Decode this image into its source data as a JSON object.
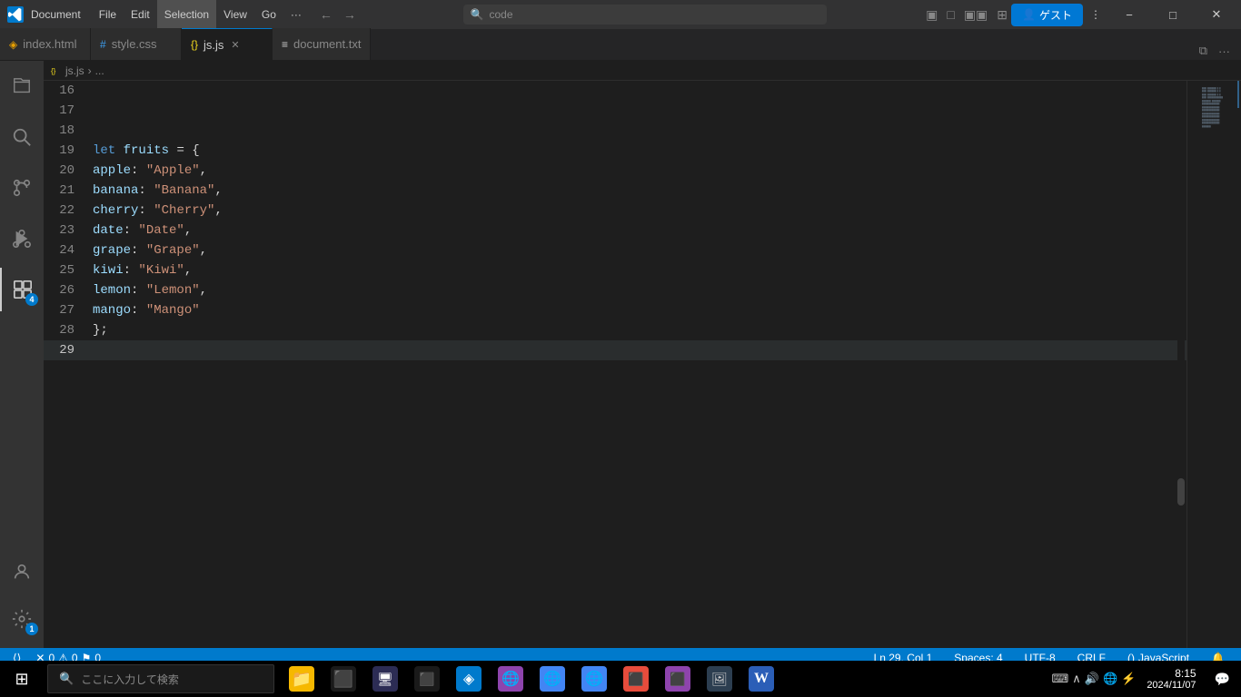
{
  "titlebar": {
    "app_icon": "VS",
    "doc_title": "Document",
    "menu": [
      "File",
      "Edit",
      "Selection",
      "View",
      "Go",
      "···"
    ],
    "search_placeholder": "code",
    "nav_back": "←",
    "nav_fwd": "→",
    "layout_btns": [
      "▣",
      "□",
      "▣▣",
      "⊞"
    ],
    "minimize": "−",
    "maximize": "□",
    "restore": "❐",
    "close": "✕",
    "outer_minimize": "—",
    "outer_maximize": "❐",
    "outer_close": "✕"
  },
  "tabs": [
    {
      "id": "index-html",
      "icon": "◈",
      "name": "index.html",
      "closable": false,
      "active": false,
      "color": "#e8a000"
    },
    {
      "id": "style-css",
      "icon": "#",
      "name": "style.css",
      "closable": false,
      "active": false,
      "color": "#3d9ded"
    },
    {
      "id": "js-js",
      "icon": "{}",
      "name": "js.js",
      "closable": true,
      "active": true,
      "color": "#f5dd1d"
    },
    {
      "id": "document-txt",
      "icon": "≡",
      "name": "document.txt",
      "closable": false,
      "active": false,
      "color": "#cccccc"
    }
  ],
  "breadcrumb": {
    "file": "js.js",
    "separator": "›",
    "rest": "..."
  },
  "code": {
    "lines": [
      {
        "num": 16,
        "content": "",
        "tokens": []
      },
      {
        "num": 17,
        "content": "",
        "tokens": []
      },
      {
        "num": 18,
        "content": "",
        "tokens": []
      },
      {
        "num": 19,
        "content": "let fruits = {",
        "tokens": [
          {
            "type": "kw",
            "text": "let"
          },
          {
            "type": "space",
            "text": " "
          },
          {
            "type": "var",
            "text": "fruits"
          },
          {
            "type": "op",
            "text": " = "
          },
          {
            "type": "brace",
            "text": "{"
          }
        ]
      },
      {
        "num": 20,
        "content": "    apple: \"Apple\",",
        "tokens": [
          {
            "type": "indent",
            "text": "    "
          },
          {
            "type": "key",
            "text": "apple"
          },
          {
            "type": "punct",
            "text": ": "
          },
          {
            "type": "str",
            "text": "\"Apple\""
          },
          {
            "type": "punct",
            "text": ","
          }
        ]
      },
      {
        "num": 21,
        "content": "    banana: \"Banana\",",
        "tokens": [
          {
            "type": "indent",
            "text": "    "
          },
          {
            "type": "key",
            "text": "banana"
          },
          {
            "type": "punct",
            "text": ": "
          },
          {
            "type": "str",
            "text": "\"Banana\""
          },
          {
            "type": "punct",
            "text": ","
          }
        ]
      },
      {
        "num": 22,
        "content": "    cherry: \"Cherry\",",
        "tokens": [
          {
            "type": "indent",
            "text": "    "
          },
          {
            "type": "key",
            "text": "cherry"
          },
          {
            "type": "punct",
            "text": ": "
          },
          {
            "type": "str",
            "text": "\"Cherry\""
          },
          {
            "type": "punct",
            "text": ","
          }
        ]
      },
      {
        "num": 23,
        "content": "    date: \"Date\",",
        "tokens": [
          {
            "type": "indent",
            "text": "    "
          },
          {
            "type": "key",
            "text": "date"
          },
          {
            "type": "punct",
            "text": ": "
          },
          {
            "type": "str",
            "text": "\"Date\""
          },
          {
            "type": "punct",
            "text": ","
          }
        ]
      },
      {
        "num": 24,
        "content": "    grape: \"Grape\",",
        "tokens": [
          {
            "type": "indent",
            "text": "    "
          },
          {
            "type": "key",
            "text": "grape"
          },
          {
            "type": "punct",
            "text": ": "
          },
          {
            "type": "str",
            "text": "\"Grape\""
          },
          {
            "type": "punct",
            "text": ","
          }
        ]
      },
      {
        "num": 25,
        "content": "    kiwi: \"Kiwi\",",
        "tokens": [
          {
            "type": "indent",
            "text": "    "
          },
          {
            "type": "key",
            "text": "kiwi"
          },
          {
            "type": "punct",
            "text": ": "
          },
          {
            "type": "str",
            "text": "\"Kiwi\""
          },
          {
            "type": "punct",
            "text": ","
          }
        ]
      },
      {
        "num": 26,
        "content": "    lemon: \"Lemon\",",
        "tokens": [
          {
            "type": "indent",
            "text": "    "
          },
          {
            "type": "key",
            "text": "lemon"
          },
          {
            "type": "punct",
            "text": ": "
          },
          {
            "type": "str",
            "text": "\"Lemon\""
          },
          {
            "type": "punct",
            "text": ","
          }
        ]
      },
      {
        "num": 27,
        "content": "    mango: \"Mango\"",
        "tokens": [
          {
            "type": "indent",
            "text": "    "
          },
          {
            "type": "key",
            "text": "mango"
          },
          {
            "type": "punct",
            "text": ": "
          },
          {
            "type": "str",
            "text": "\"Mango\""
          }
        ]
      },
      {
        "num": 28,
        "content": "};",
        "tokens": [
          {
            "type": "brace",
            "text": "}"
          },
          {
            "type": "punct",
            "text": ";"
          }
        ]
      },
      {
        "num": 29,
        "content": "",
        "tokens": [],
        "current": true
      }
    ]
  },
  "status": {
    "errors": "0",
    "warnings": "0",
    "messages": "0",
    "line": "Ln 29, Col 1",
    "spaces": "Spaces: 4",
    "encoding": "UTF-8",
    "eol": "CRLF",
    "language": "JavaScript",
    "notifications": "🔔"
  },
  "activity": {
    "items": [
      {
        "id": "explorer",
        "icon": "⧉",
        "active": false
      },
      {
        "id": "search",
        "icon": "🔍",
        "active": false
      },
      {
        "id": "source-control",
        "icon": "⑂",
        "active": false
      },
      {
        "id": "run-debug",
        "icon": "▷",
        "active": false
      },
      {
        "id": "extensions",
        "icon": "⊞",
        "active": true,
        "badge": "4"
      }
    ],
    "bottom": [
      {
        "id": "account",
        "icon": "👤"
      },
      {
        "id": "settings",
        "icon": "⚙",
        "badge": "1"
      }
    ]
  },
  "taskbar": {
    "start_icon": "⊞",
    "search_placeholder": "ここに入力して検索",
    "apps": [
      {
        "id": "file-explorer",
        "icon": "📁",
        "color": "#f6b800"
      },
      {
        "id": "terminal",
        "icon": "⬛",
        "color": "#000"
      },
      {
        "id": "app3",
        "icon": "⬛",
        "color": "#333"
      },
      {
        "id": "app4",
        "icon": "⬛",
        "color": "#333"
      },
      {
        "id": "vscode-blue",
        "icon": "◈",
        "color": "#007acc"
      },
      {
        "id": "browser-purple",
        "icon": "🌐",
        "color": "#9b59b6"
      },
      {
        "id": "browser-chrome",
        "icon": "🌐",
        "color": "#4285f4"
      },
      {
        "id": "browser-alt",
        "icon": "🌐",
        "color": "#4285f4"
      },
      {
        "id": "app-red",
        "icon": "⬛",
        "color": "#e74c3c"
      },
      {
        "id": "app-purple2",
        "icon": "⬛",
        "color": "#8e44ad"
      },
      {
        "id": "app-photo",
        "icon": "🖼",
        "color": "#2c3e50"
      },
      {
        "id": "word",
        "icon": "W",
        "color": "#2b5eb7"
      }
    ],
    "tray": [
      "⌨",
      "∧",
      "🔊",
      "🌐",
      "⚡"
    ],
    "time": "8:15",
    "date": "2024/11/07",
    "notification_icon": "💬"
  },
  "guest_button": "ゲスト"
}
